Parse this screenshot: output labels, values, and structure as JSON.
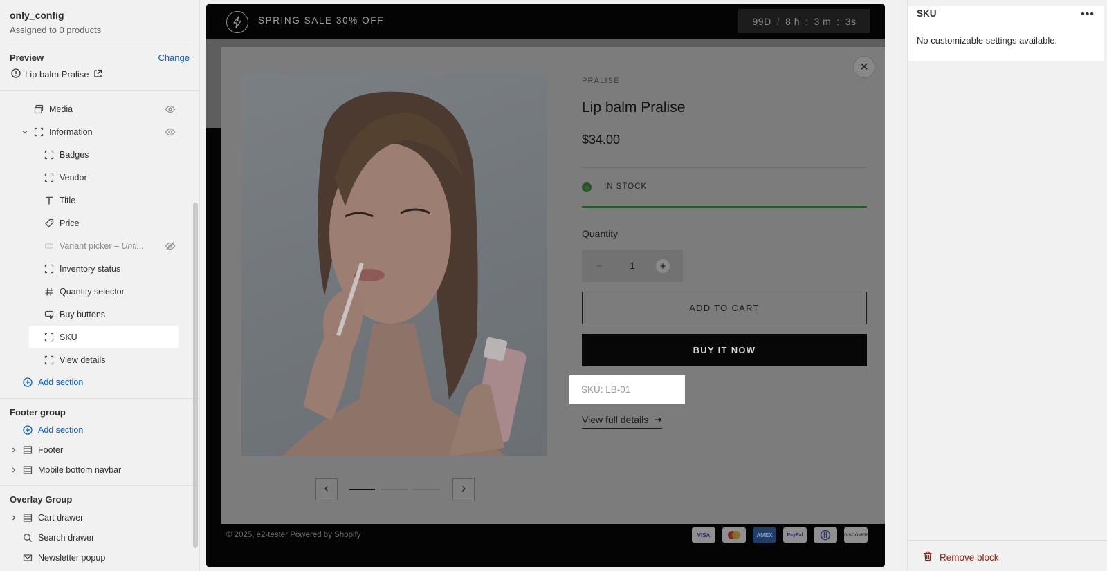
{
  "sidebar": {
    "template_name": "only_config",
    "assigned": "Assigned to 0 products",
    "preview_label": "Preview",
    "change_label": "Change",
    "preview_product": "Lip balm Pralise",
    "tree": {
      "media": "Media",
      "information": "Information",
      "badges": "Badges",
      "vendor": "Vendor",
      "title": "Title",
      "price": "Price",
      "variant_picker": "Variant picker",
      "variant_picker_suffix": "– Unti...",
      "inventory_status": "Inventory status",
      "quantity_selector": "Quantity selector",
      "buy_buttons": "Buy buttons",
      "sku": "SKU",
      "view_details": "View details",
      "add_section": "Add section"
    },
    "footer_group": {
      "title": "Footer group",
      "add_section": "Add section",
      "footer": "Footer",
      "mobile_navbar": "Mobile bottom navbar"
    },
    "overlay_group": {
      "title": "Overlay Group",
      "cart_drawer": "Cart drawer",
      "search_drawer": "Search drawer",
      "newsletter_popup": "Newsletter popup"
    }
  },
  "store": {
    "announcement": "SPRING SALE 30% OFF",
    "countdown": {
      "days": "99D",
      "hours": "8 h",
      "minutes": "3 m",
      "seconds": "3",
      "seconds_unit": "s"
    },
    "footer_copy": "© 2025, e2-tester Powered by Shopify",
    "payments": [
      "VISA",
      "MC",
      "AMEX",
      "PayPal",
      "Diners",
      "DISCOVER"
    ]
  },
  "modal": {
    "vendor": "PRALISE",
    "title": "Lip balm Pralise",
    "price": "$34.00",
    "stock": "IN STOCK",
    "quantity_label": "Quantity",
    "quantity_value": "1",
    "add_to_cart": "ADD TO CART",
    "buy_now": "BUY IT NOW",
    "sku": "SKU: LB-01",
    "view_full": "View full details",
    "carousel": {
      "slides": 3,
      "active": 1
    }
  },
  "right_panel": {
    "title": "SKU",
    "message": "No customizable settings available.",
    "remove": "Remove block"
  },
  "colors": {
    "accent": "#005bd3",
    "danger": "#8e1f0b",
    "stock_green": "#235c23"
  }
}
